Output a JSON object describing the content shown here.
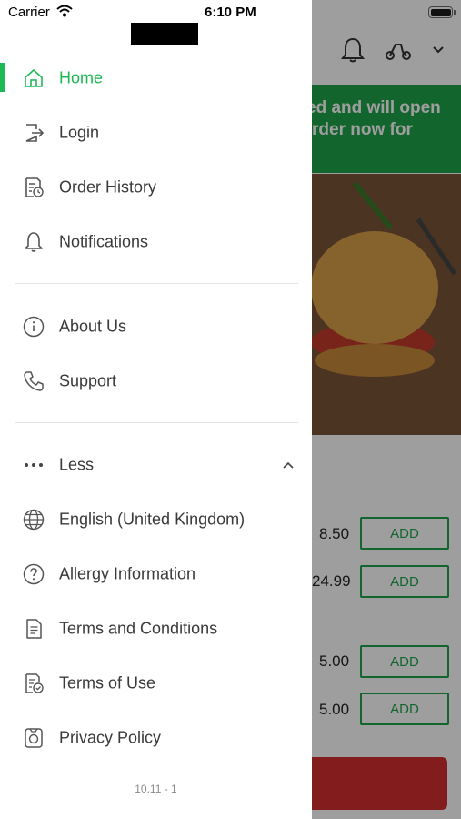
{
  "status_bar": {
    "carrier": "Carrier",
    "time": "6:10 PM"
  },
  "background": {
    "banner_line1": "ed and will open",
    "banner_line2": "rder now for",
    "items": [
      {
        "price": "8.50",
        "button": "ADD"
      },
      {
        "price": "24.99",
        "button": "ADD"
      },
      {
        "price": "5.00",
        "button": "ADD"
      },
      {
        "price": "5.00",
        "button": "ADD"
      }
    ]
  },
  "drawer": {
    "primary": [
      {
        "label": "Home",
        "icon": "home-icon",
        "active": true
      },
      {
        "label": "Login",
        "icon": "login-icon"
      },
      {
        "label": "Order History",
        "icon": "order-history-icon"
      },
      {
        "label": "Notifications",
        "icon": "bell-icon"
      }
    ],
    "secondary": [
      {
        "label": "About Us",
        "icon": "info-icon"
      },
      {
        "label": "Support",
        "icon": "phone-icon"
      }
    ],
    "more": {
      "toggle_label": "Less",
      "items": [
        {
          "label": "English (United Kingdom)",
          "icon": "globe-icon"
        },
        {
          "label": "Allergy Information",
          "icon": "help-circle-icon"
        },
        {
          "label": "Terms and Conditions",
          "icon": "document-icon"
        },
        {
          "label": "Terms of Use",
          "icon": "document-check-icon"
        },
        {
          "label": "Privacy Policy",
          "icon": "privacy-icon"
        }
      ]
    },
    "version": "10.11 - 1"
  },
  "colors": {
    "accent": "#1db954",
    "banner": "#1ea34a",
    "cart": "#d32f2f",
    "text": "#3a3a3a"
  }
}
